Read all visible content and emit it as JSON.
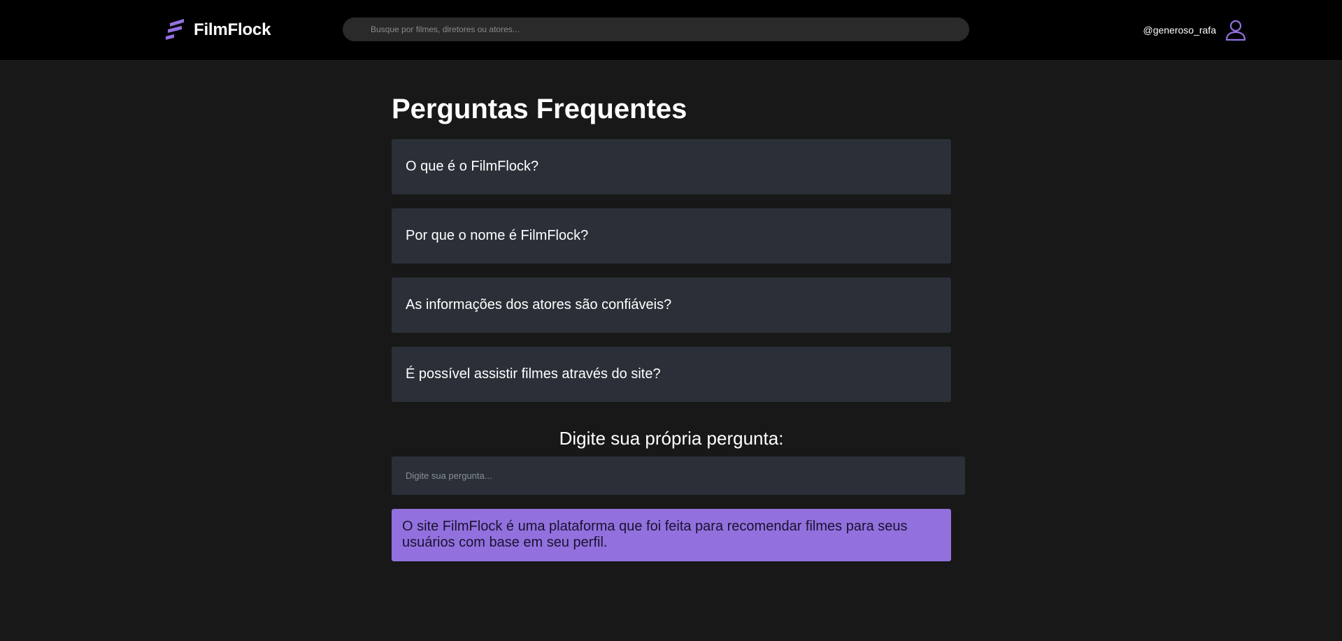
{
  "header": {
    "logo_text": "FilmFlock",
    "search_placeholder": "Busque por filmes, diretores ou atores...",
    "username": "@generoso_rafa"
  },
  "colors": {
    "accent": "#9271de",
    "card_bg": "#2b3038",
    "page_bg": "#181818",
    "topbar_bg": "#000000"
  },
  "icons": {
    "logo": "filmflock-logo-icon",
    "user": "user-icon"
  },
  "faq": {
    "title": "Perguntas Frequentes",
    "items": [
      {
        "question": "O que é o FilmFlock?"
      },
      {
        "question": "Por que o nome é FilmFlock?"
      },
      {
        "question": "As informações dos atores são confiáveis?"
      },
      {
        "question": "É possível assistir filmes através do site?"
      }
    ]
  },
  "ask": {
    "title": "Digite sua própria pergunta:",
    "placeholder": "Digite sua pergunta...",
    "answer": "O site FilmFlock é uma plataforma que foi feita para recomendar filmes para seus usuários com base em seu perfil."
  }
}
